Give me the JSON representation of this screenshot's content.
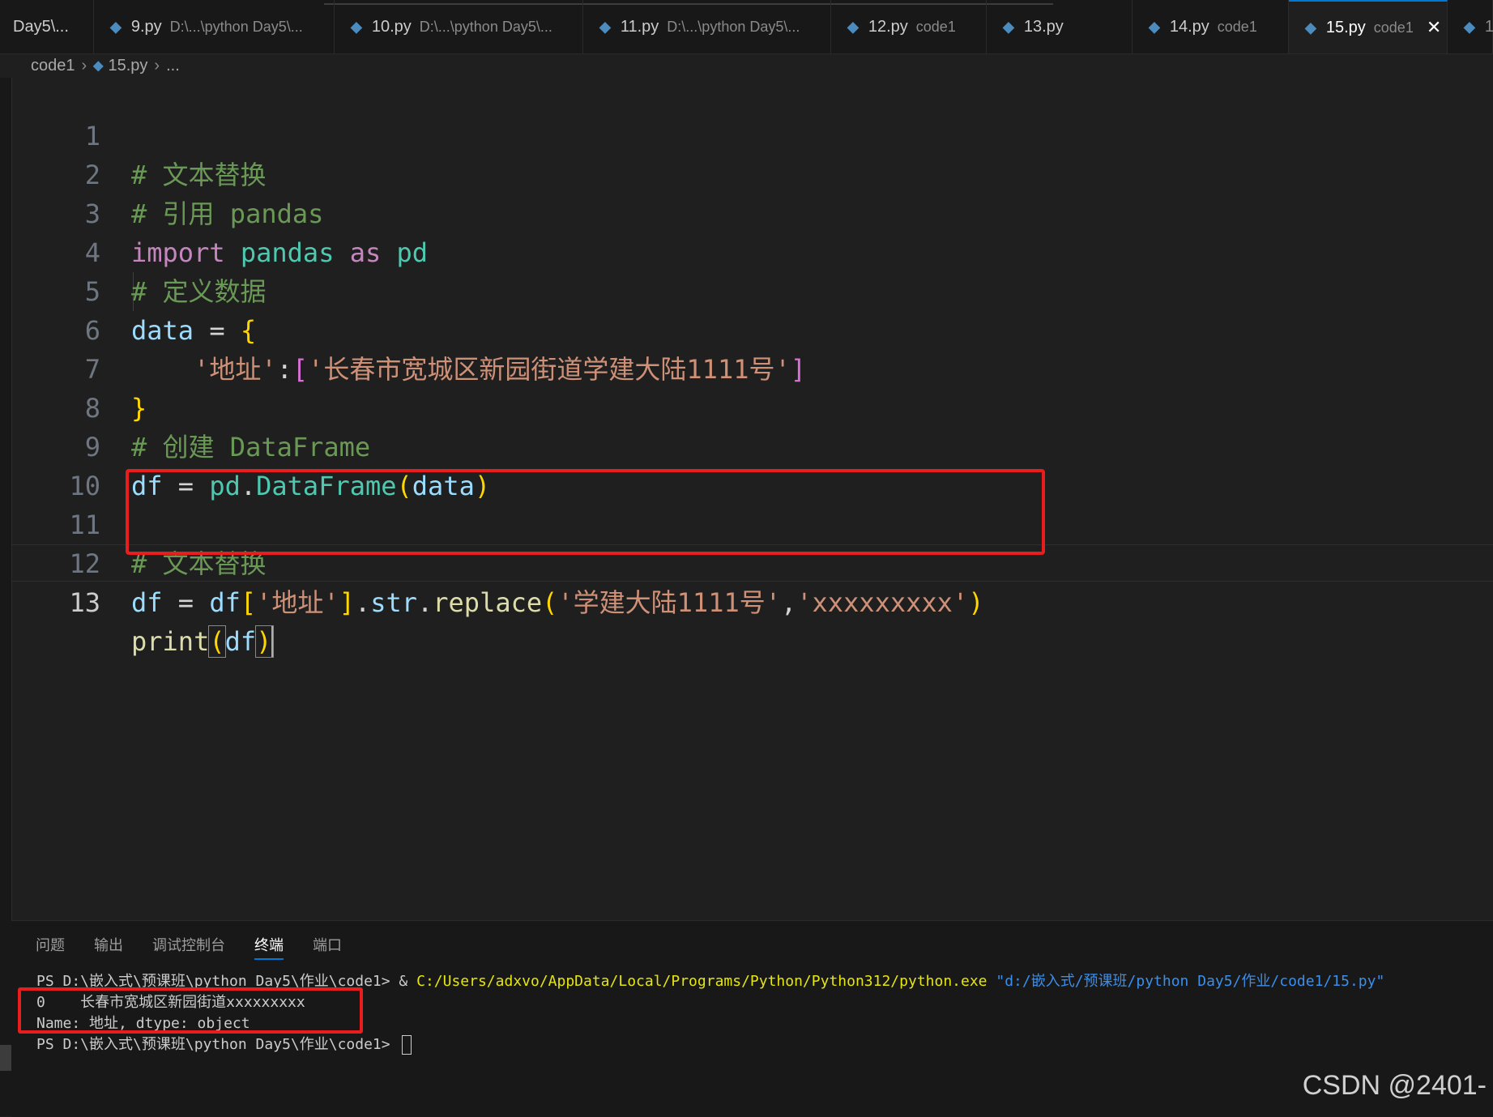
{
  "tabs": [
    {
      "name": "Day5\\...",
      "desc": ""
    },
    {
      "name": "9.py",
      "desc": "D:\\...\\python Day5\\..."
    },
    {
      "name": "10.py",
      "desc": "D:\\...\\python Day5\\..."
    },
    {
      "name": "11.py",
      "desc": "D:\\...\\python Day5\\..."
    },
    {
      "name": "12.py",
      "desc": "code1"
    },
    {
      "name": "13.py",
      "desc": ""
    },
    {
      "name": "14.py",
      "desc": "code1"
    },
    {
      "name": "15.py",
      "desc": "code1"
    },
    {
      "name": "1",
      "desc": ""
    }
  ],
  "breadcrumb": {
    "folder": "code1",
    "file": "15.py",
    "more": "..."
  },
  "line_numbers": [
    "1",
    "2",
    "3",
    "4",
    "5",
    "6",
    "7",
    "8",
    "9",
    "10",
    "11",
    "12",
    "13"
  ],
  "code": {
    "l1_comment": "# 文本替换",
    "l2_comment": "# 引用 pandas",
    "l3": {
      "import": "import",
      "module": "pandas",
      "as": "as",
      "alias": "pd"
    },
    "l4_comment": "# 定义数据",
    "l5": {
      "var": "data",
      "op": " = ",
      "brace": "{"
    },
    "l6": {
      "key": "'地址'",
      "colon": ":",
      "lb": "[",
      "value": "'长春市宽城区新园街道学建大陆1111号'",
      "rb": "]"
    },
    "l7": {
      "brace": "}"
    },
    "l8_comment": "# 创建 DataFrame",
    "l9": {
      "var": "df",
      "op": " = ",
      "mod": "pd",
      "dot": ".",
      "cls": "DataFrame",
      "lp": "(",
      "arg": "data",
      "rp": ")"
    },
    "l11_comment": "# 文本替换",
    "l12": {
      "var": "df",
      "op": " = ",
      "obj": "df",
      "lb": "[",
      "key": "'地址'",
      "rb": "]",
      "dot1": ".",
      "attr": "str",
      "dot2": ".",
      "fn": "replace",
      "lp": "(",
      "arg1": "'学建大陆1111号'",
      "comma": ",",
      "arg2": "'xxxxxxxxx'",
      "rp": ")"
    },
    "l13": {
      "fn": "print",
      "lp": "(",
      "arg": "df",
      "rp": ")"
    }
  },
  "panel": {
    "tabs": [
      "问题",
      "输出",
      "调试控制台",
      "终端",
      "端口"
    ],
    "active_tab": "终端"
  },
  "terminal": {
    "prompt1": "PS D:\\嵌入式\\预课班\\python Day5\\作业\\code1> & ",
    "exe": "C:/Users/adxvo/AppData/Local/Programs/Python/Python312/python.exe",
    "script": " \"d:/嵌入式/预课班/python Day5/作业/code1/15.py\"",
    "out1": "0    长春市宽城区新园街道xxxxxxxxx",
    "out2": "Name: 地址, dtype: object",
    "prompt2": "PS D:\\嵌入式\\预课班\\python Day5\\作业\\code1> "
  },
  "watermark": "CSDN @2401-",
  "colors": {
    "highlight_red": "#e81d1d",
    "accent_blue": "#0078d4"
  }
}
